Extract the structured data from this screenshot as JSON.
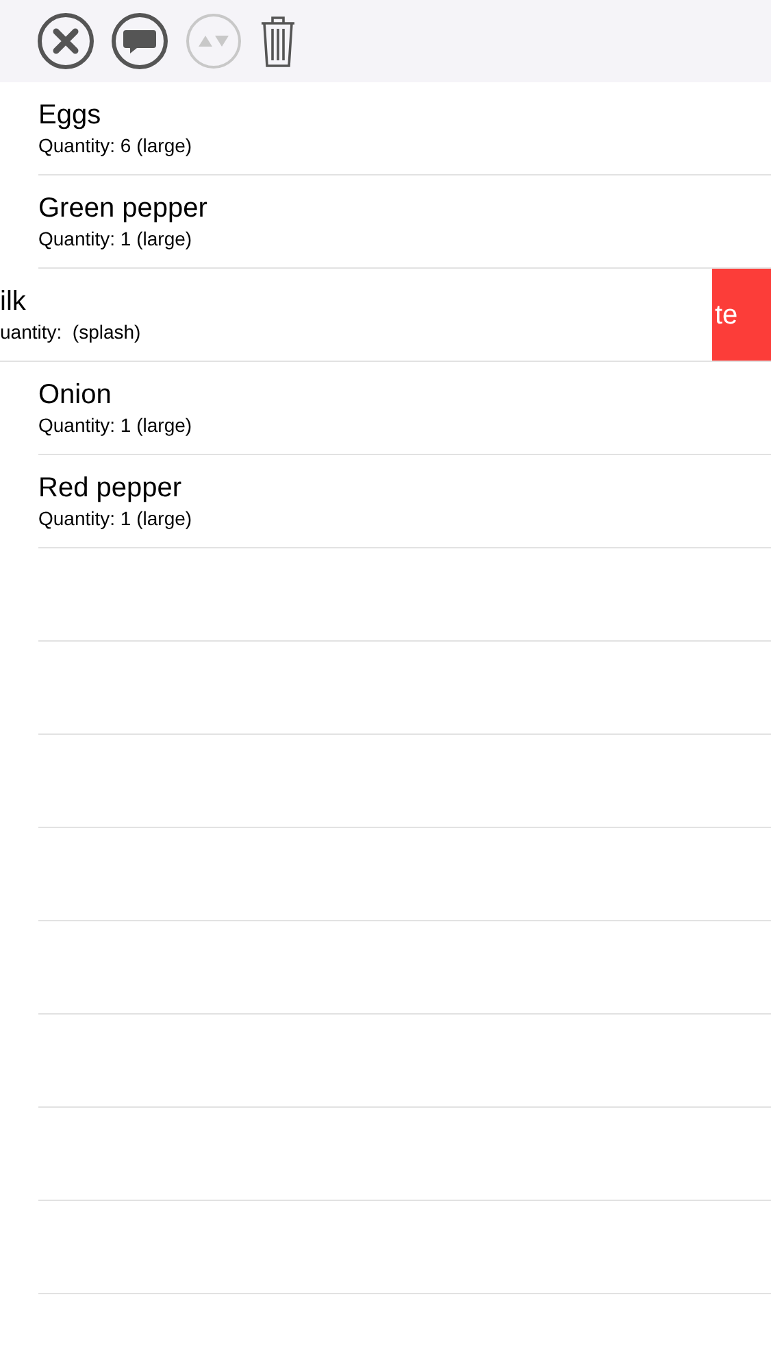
{
  "toolbar": [
    {
      "kind": "cancel",
      "disabled": false
    },
    {
      "kind": "comment",
      "disabled": false
    },
    {
      "kind": "sort",
      "disabled": true
    },
    {
      "kind": "trash",
      "disabled": false
    }
  ],
  "items": [
    {
      "name": "Eggs",
      "quantity": "Quantity: 6 (large)",
      "swiped": false
    },
    {
      "name": "Green pepper",
      "quantity": "Quantity: 1 (large)",
      "swiped": false
    },
    {
      "name": "ilk",
      "quantity": "uantity:  (splash)",
      "swiped": true,
      "action": "te"
    },
    {
      "name": "Onion",
      "quantity": "Quantity: 1 (large)",
      "swiped": false
    },
    {
      "name": "Red pepper",
      "quantity": "Quantity: 1 (large)",
      "swiped": false
    }
  ]
}
